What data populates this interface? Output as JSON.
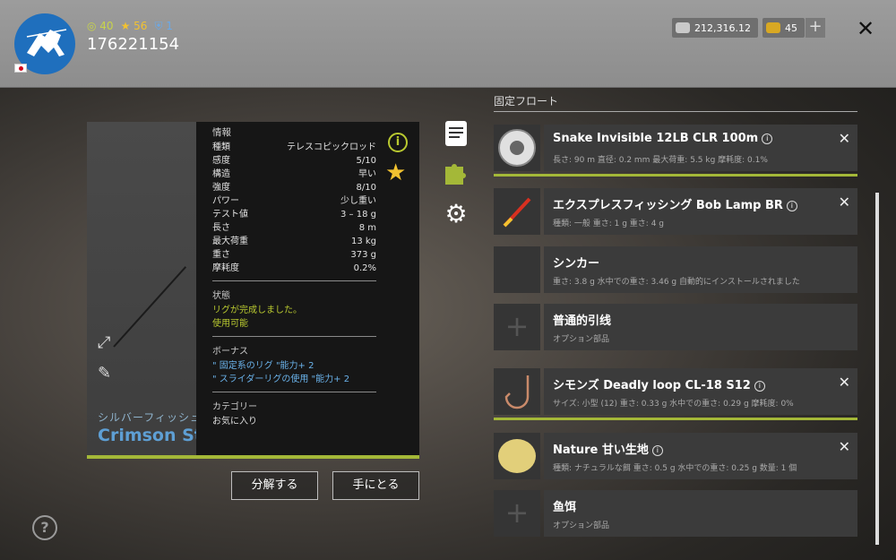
{
  "header": {
    "level": "40",
    "stars": "56",
    "shield": "1",
    "player_id": "176221154",
    "silver": "212,316.12",
    "gold": "45",
    "plus": "+",
    "close": "✕"
  },
  "rod": {
    "brand": "シルバーフィッシュ",
    "name": "Crimson St...",
    "info_title": "情報",
    "stats": [
      {
        "label": "種類",
        "value": "テレスコピックロッド"
      },
      {
        "label": "感度",
        "value": "5/10"
      },
      {
        "label": "構造",
        "value": "早い"
      },
      {
        "label": "強度",
        "value": "8/10"
      },
      {
        "label": "パワー",
        "value": "少し重い"
      },
      {
        "label": "テスト値",
        "value": "3 – 18 g"
      },
      {
        "label": "長さ",
        "value": "8 m"
      },
      {
        "label": "最大荷重",
        "value": "13 kg"
      },
      {
        "label": "重さ",
        "value": "373 g"
      },
      {
        "label": "摩耗度",
        "value": "0.2%"
      }
    ],
    "status_title": "状態",
    "status_line1": "リグが完成しました。",
    "status_line2": "使用可能",
    "bonus_title": "ボーナス",
    "bonus_line1": "\" 固定系のリグ \"能力+ 2",
    "bonus_line2": "\" スライダーリグの使用 \"能力+ 2",
    "category_title": "カテゴリー",
    "category_value": "お気に入り"
  },
  "buttons": {
    "disassemble": "分解する",
    "take": "手にとる"
  },
  "list": {
    "header": "固定フロート",
    "items": [
      {
        "title": "Snake Invisible 12LB CLR 100m",
        "sub": "長さ: 90 m  直径: 0.2 mm  最大荷重: 5.5 kg  摩耗度: 0.1%"
      },
      {
        "title": "エクスプレスフィッシング Bob Lamp BR",
        "sub": "種類: 一般  重さ: 1 g  重さ: 4 g"
      },
      {
        "title": "シンカー",
        "sub": "重さ: 3.8 g  水中での重さ: 3.46 g  自動的にインストールされました"
      },
      {
        "title": "普通的引线",
        "sub": "オプション部品"
      },
      {
        "title": "シモンズ Deadly loop CL-18 S12",
        "sub": "サイズ: 小型 (12)  重さ: 0.33 g  水中での重さ: 0.29 g  摩耗度: 0%"
      },
      {
        "title": "Nature 甘い生地",
        "sub": "種類: ナチュラルな餌  重さ: 0.5 g  水中での重さ: 0.25 g  数量: 1 個"
      },
      {
        "title": "鱼饵",
        "sub": "オプション部品"
      }
    ]
  },
  "help": "?",
  "colors": {
    "accent_green": "#a4b838",
    "accent_yellow": "#b9c930",
    "star": "#f2c230",
    "link_blue": "#6ab2ea"
  }
}
